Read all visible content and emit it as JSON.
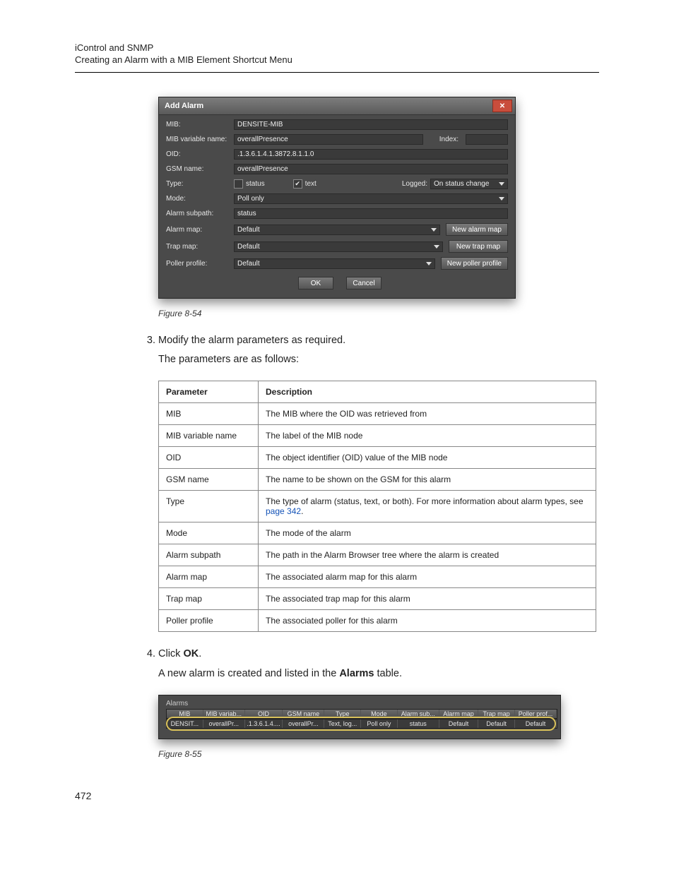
{
  "header": {
    "line1": "iControl and SNMP",
    "line2": "Creating an Alarm with a MIB Element Shortcut Menu"
  },
  "dialog": {
    "title": "Add Alarm",
    "rows": {
      "mib_label": "MIB:",
      "mib_value": "DENSITE-MIB",
      "var_label": "MIB variable name:",
      "var_value": "overallPresence",
      "index_label": "Index:",
      "index_value": "",
      "oid_label": "OID:",
      "oid_value": ".1.3.6.1.4.1.3872.8.1.1.0",
      "gsm_label": "GSM name:",
      "gsm_value": "overallPresence",
      "type_label": "Type:",
      "type_status": "status",
      "type_text": "text",
      "logged_label": "Logged:",
      "logged_value": "On status change",
      "mode_label": "Mode:",
      "mode_value": "Poll only",
      "subpath_label": "Alarm subpath:",
      "subpath_value": "status",
      "alarm_map_label": "Alarm map:",
      "alarm_map_value": "Default",
      "alarm_map_btn": "New alarm map",
      "trap_map_label": "Trap map:",
      "trap_map_value": "Default",
      "trap_map_btn": "New trap map",
      "poller_label": "Poller profile:",
      "poller_value": "Default",
      "poller_btn": "New poller profile",
      "ok_btn": "OK",
      "cancel_btn": "Cancel"
    }
  },
  "fig1": "Figure 8-54",
  "step3_a": "Modify the alarm parameters as required.",
  "step3_b": "The parameters are as follows:",
  "params_table": {
    "head_param": "Parameter",
    "head_desc": "Description",
    "rows": [
      {
        "p": "MIB",
        "d": "The MIB where the OID was retrieved from"
      },
      {
        "p": "MIB variable name",
        "d": "The label of the MIB node"
      },
      {
        "p": "OID",
        "d": "The object identifier (OID) value of the MIB node"
      },
      {
        "p": "GSM name",
        "d": "The name to be shown on the GSM for this alarm"
      },
      {
        "p": "Type",
        "d": "The type of alarm (status, text, or both). For more information about alarm types, see ",
        "link": "page 342",
        "tail": "."
      },
      {
        "p": "Mode",
        "d": "The mode of the alarm"
      },
      {
        "p": "Alarm subpath",
        "d": "The path in the Alarm Browser tree where the alarm is created"
      },
      {
        "p": "Alarm map",
        "d": "The associated alarm map for this alarm"
      },
      {
        "p": "Trap map",
        "d": "The associated trap map for this alarm"
      },
      {
        "p": "Poller profile",
        "d": "The associated poller for this alarm"
      }
    ]
  },
  "step4_a_pre": "Click ",
  "step4_a_bold": "OK",
  "step4_a_post": ".",
  "step4_b_pre": "A new alarm is created and listed in the ",
  "step4_b_bold": "Alarms",
  "step4_b_post": " table.",
  "alarms_panel": {
    "legend": "Alarms",
    "headers": [
      "MIB",
      "MIB variab...",
      "OID",
      "GSM name",
      "Type",
      "Mode",
      "Alarm sub...",
      "Alarm map",
      "Trap map",
      "Poller prof..."
    ],
    "row": [
      "DENSIT...",
      "overallPr...",
      ".1.3.6.1.4....",
      "overallPr...",
      "Text, log...",
      "Poll only",
      "status",
      "Default",
      "Default",
      "Default"
    ]
  },
  "fig2": "Figure 8-55",
  "page_number": "472"
}
